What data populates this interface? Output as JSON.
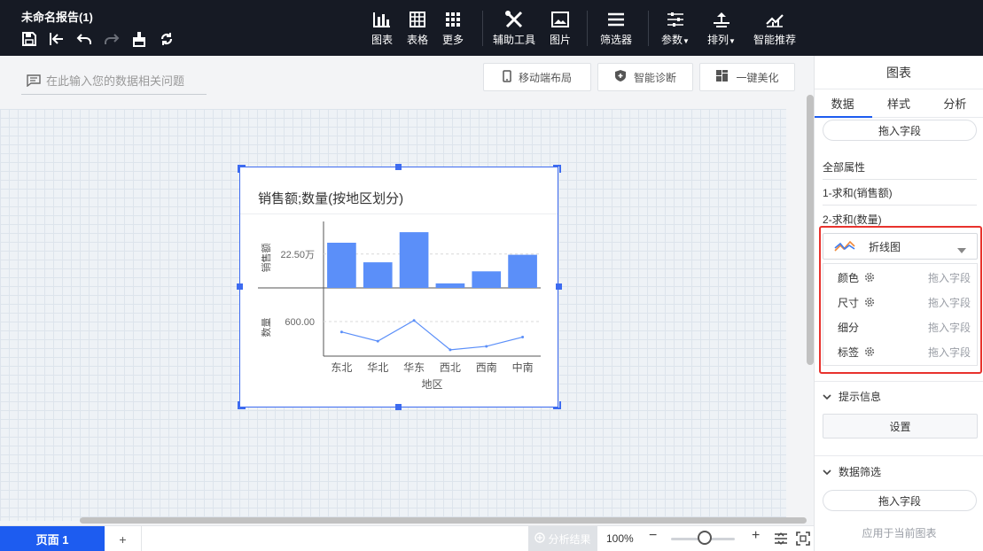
{
  "app": {
    "title": "未命名报告(1)"
  },
  "toolbar": {
    "items": [
      {
        "label": "图表"
      },
      {
        "label": "表格"
      },
      {
        "label": "更多"
      },
      {
        "label": "辅助工具"
      },
      {
        "label": "图片"
      },
      {
        "label": "筛选器"
      },
      {
        "label": "参数"
      },
      {
        "label": "排列"
      },
      {
        "label": "智能推荐"
      }
    ]
  },
  "canvas": {
    "ask_placeholder": "在此输入您的数据相关问题",
    "mobile_layout": "移动端布局",
    "smart_diagnosis": "智能诊断",
    "beautify": "一键美化"
  },
  "widget": {
    "title": "销售额;数量(按地区划分)"
  },
  "chart_data": {
    "type": "bar",
    "title": "销售额;数量(按地区划分)",
    "xlabel": "地区",
    "categories": [
      "东北",
      "华北",
      "华东",
      "西北",
      "西南",
      "中南"
    ],
    "panels": [
      {
        "type": "bar",
        "ylabel": "销售额",
        "tick_label": "22.50万",
        "tick_value": 225000,
        "ylim": [
          0,
          400000
        ],
        "series": [
          {
            "values": [
              300000,
              170000,
              370000,
              30000,
              110000,
              220000
            ]
          }
        ],
        "color": "#5b8ff9"
      },
      {
        "type": "line",
        "ylabel": "数量",
        "tick_label": "600.00",
        "tick_value": 600,
        "ylim": [
          0,
          1000
        ],
        "series": [
          {
            "values": [
              420,
              260,
              620,
              110,
              170,
              330
            ]
          }
        ],
        "color": "#5b8ff9"
      }
    ]
  },
  "bottom": {
    "page_tab": "页面 1",
    "add_page": "+",
    "analysis": "分析结果",
    "zoom": "100%"
  },
  "panel": {
    "title": "图表",
    "tabs": [
      "数据",
      "样式",
      "分析"
    ],
    "drop_field": "拖入字段",
    "attrs": {
      "all": "全部属性",
      "sum_sales": "1-求和(销售额)",
      "sum_qty": "2-求和(数量)"
    },
    "chart_type": "折线图",
    "props": [
      {
        "name": "颜色",
        "drop": "拖入字段",
        "gear": true
      },
      {
        "name": "尺寸",
        "drop": "拖入字段",
        "gear": true
      },
      {
        "name": "细分",
        "drop": "拖入字段",
        "gear": false
      },
      {
        "name": "标签",
        "drop": "拖入字段",
        "gear": true
      }
    ],
    "tooltip_section": "提示信息",
    "tooltip_button": "设置",
    "filter_section": "数据筛选",
    "filter_drop": "拖入字段",
    "apply_current": "应用于当前图表"
  }
}
